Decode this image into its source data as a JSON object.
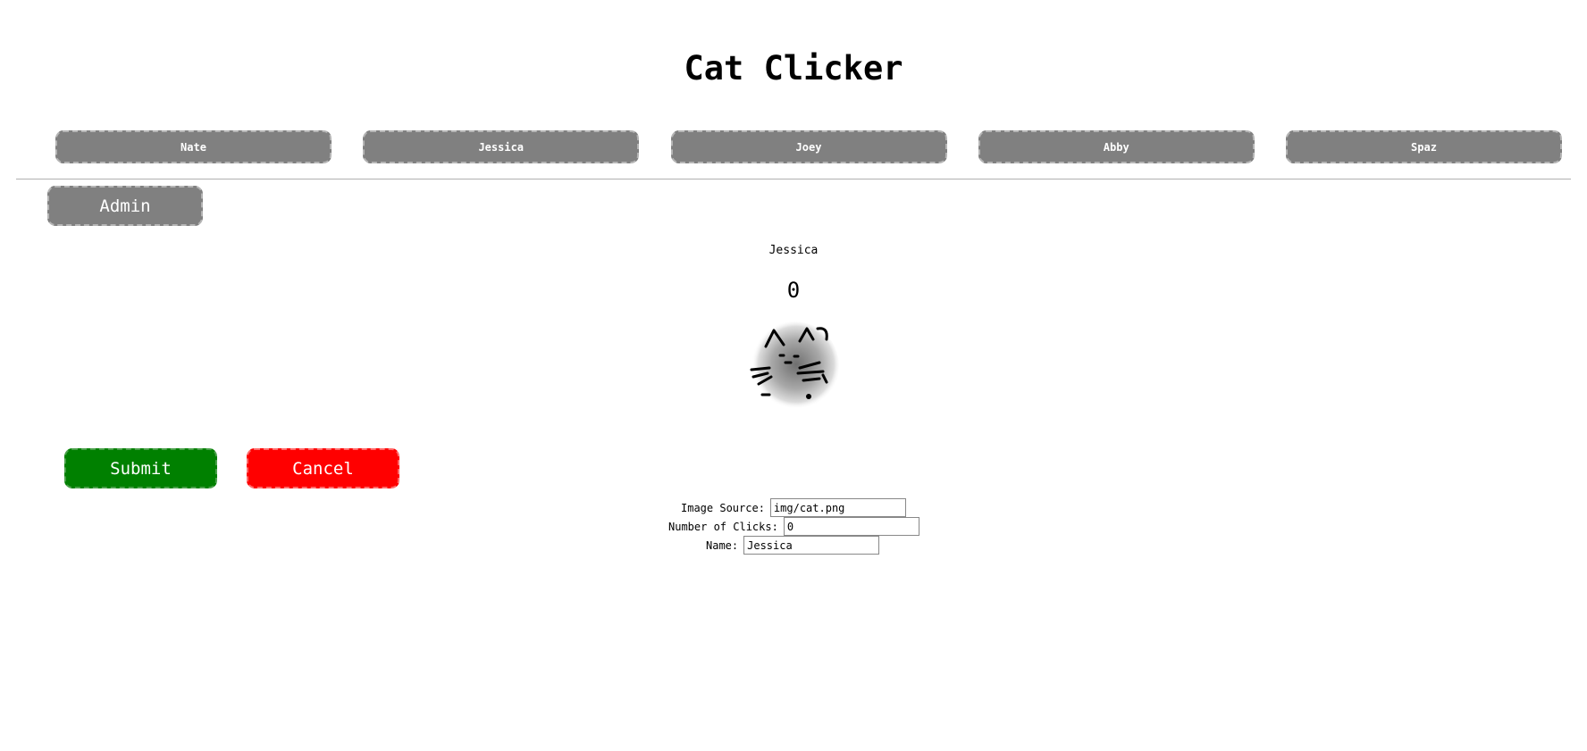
{
  "header": {
    "title": "Cat Clicker"
  },
  "cat_list": {
    "cats": [
      {
        "name": "Nate"
      },
      {
        "name": "Jessica"
      },
      {
        "name": "Joey"
      },
      {
        "name": "Abby"
      },
      {
        "name": "Spaz"
      }
    ]
  },
  "admin": {
    "label": "Admin",
    "submit_label": "Submit",
    "cancel_label": "Cancel"
  },
  "current_cat": {
    "name": "Jessica",
    "clicks": "0",
    "image_icon": "cat-sketch-icon"
  },
  "form": {
    "image_source_label": "Image Source:",
    "image_source_value": "img/cat.png",
    "clicks_label": "Number of Clicks:",
    "clicks_value": "0",
    "name_label": "Name:",
    "name_value": "Jessica"
  },
  "colors": {
    "cat_button_bg": "#808080",
    "submit_bg": "#008000",
    "cancel_bg": "#ff0000"
  }
}
